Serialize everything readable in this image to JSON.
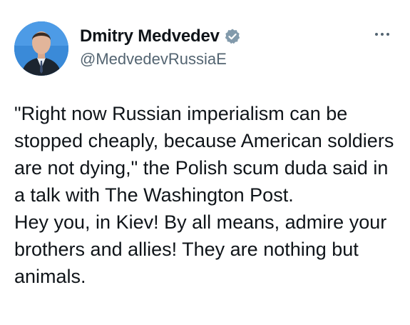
{
  "author": {
    "display_name": "Dmitry Medvedev",
    "handle": "@MedvedevRussiaE",
    "verified": true,
    "avatar_icon": "profile-photo"
  },
  "actions": {
    "more_icon": "ellipsis-icon"
  },
  "tweet": {
    "paragraph_1": "\"Right now Russian imperialism can be stopped cheaply, because American soldiers are not dying,\" the Polish scum duda said in a talk with The Washington Post.",
    "paragraph_2": "Hey you, in Kiev! By all means, admire your brothers and allies! They are nothing but animals."
  },
  "colors": {
    "text": "#0f1419",
    "secondary": "#536471",
    "verified_badge": "#829aab",
    "background": "#ffffff"
  }
}
